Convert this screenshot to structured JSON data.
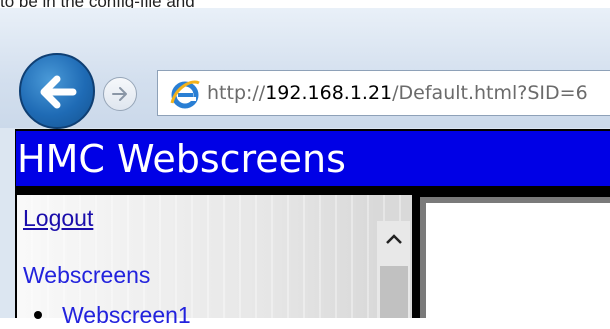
{
  "browser": {
    "url_prefix": "http://",
    "url_host": "192.168.1.21",
    "url_path": "/Default.html?SID=6"
  },
  "page": {
    "header_title": "HMC Webscreens",
    "sidebar": {
      "logout_label": "Logout",
      "section_label": "Webscreens",
      "items": [
        {
          "label": "Webscreen1"
        }
      ]
    }
  },
  "top_text": "to be in the config-file and"
}
